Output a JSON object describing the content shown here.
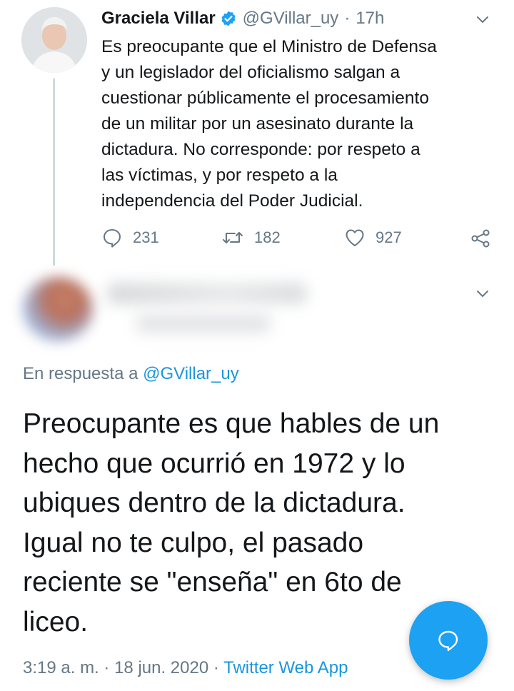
{
  "tweet": {
    "author_name": "Graciela Villar",
    "handle": "@GVillar_uy",
    "separator": "·",
    "time": "17h",
    "verified": true,
    "text_lines": [
      "Es preocupante que el Ministro de Defensa",
      "y un legislador del oficialismo salgan a",
      "cuestionar públicamente el procesamiento",
      "de un militar por un asesinato durante la",
      "dictadura. No corresponde: por respeto a",
      "las víctimas, y por respeto a la",
      "independencia del Poder Judicial."
    ],
    "counts": {
      "replies": "231",
      "retweets": "182",
      "likes": "927"
    },
    "icons": [
      "verified-badge-icon",
      "chevron-down-icon",
      "reply-icon",
      "retweet-icon",
      "like-icon",
      "share-icon"
    ]
  },
  "reply": {
    "in_reply_prefix": "En respuesta a",
    "in_reply_mention": "@GVillar_uy",
    "text_lines": [
      "Preocupante es que hables de un",
      "hecho que ocurrió en 1972 y lo",
      "ubiques dentro de la dictadura.",
      "Igual no te culpo, el pasado",
      "reciente se \"enseña\" en 6to de",
      "liceo."
    ],
    "timestamp": "3:19 a. m.",
    "separator": "·",
    "date": "18 jun. 2020",
    "source": "Twitter Web App"
  },
  "fab": {
    "icon": "compose-bubble-icon"
  },
  "colors": {
    "accent": "#1da1f2",
    "link": "#1b95e0",
    "muted": "#657786",
    "text": "#14171a"
  }
}
